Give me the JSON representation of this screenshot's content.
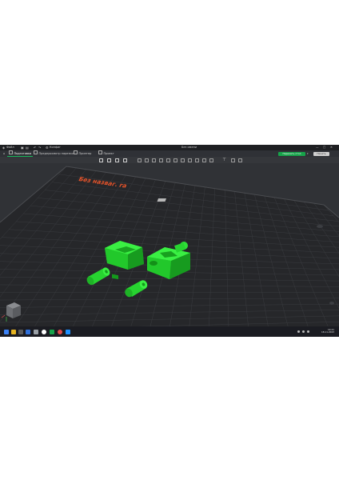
{
  "window": {
    "app_label": "Файл",
    "menu_label": "Конфиг",
    "title": "Без имени",
    "controls": {
      "minimize": "—",
      "maximize": "□",
      "close": "✕"
    }
  },
  "tabs": [
    {
      "label": "Подготовка",
      "active": true,
      "icon": "cube-icon"
    },
    {
      "label": "Предпросмотр нарезки",
      "active": false,
      "icon": "layers-icon"
    },
    {
      "label": "Принтер",
      "active": false,
      "icon": "printer-icon"
    },
    {
      "label": "Проект",
      "active": false,
      "icon": "folder-icon"
    }
  ],
  "actions": {
    "slice_label": "Нарезать стол",
    "print_label": "Печать"
  },
  "viewport": {
    "bed_label": "Без назваг. ra",
    "model_color": "#22d12a",
    "label_color": "#e8542a"
  },
  "taskbar": {
    "time": "14:21",
    "date": "18.11.2023"
  },
  "colors": {
    "accent": "#17a34a",
    "active_tab_underline": "#17b55a"
  }
}
